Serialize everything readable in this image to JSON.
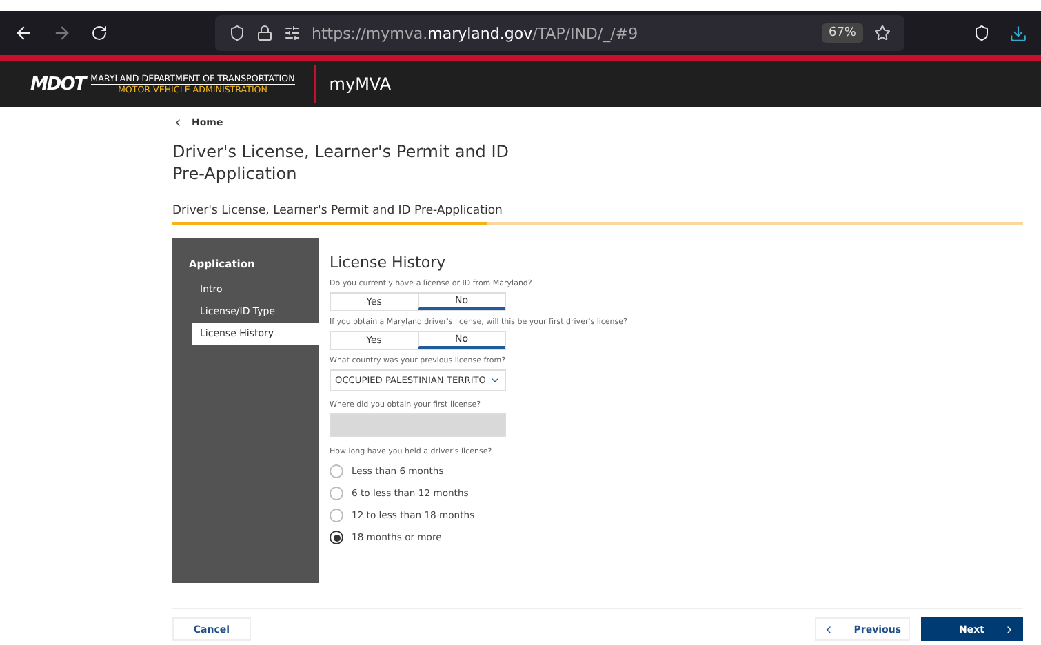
{
  "browser": {
    "url": "https://mymva.**maryland.gov**/TAP/IND/_/#9",
    "zoom": "67%"
  },
  "header": {
    "logo": "MDOT",
    "agency": "MARYLAND DEPARTMENT OF TRANSPORTATION",
    "division": "MOTOR VEHICLE ADMINISTRATION",
    "app": "myMVA"
  },
  "breadcrumb": "Home",
  "page_title": "Driver's License, Learner's Permit and ID Pre-Application",
  "section_title": "Driver's License, Learner's Permit and ID Pre-Application",
  "progress": {
    "level": 0.37
  },
  "sidebar": {
    "heading": "Application",
    "items": [
      {
        "label": "Intro",
        "selected": false
      },
      {
        "label": "License/ID Type",
        "selected": false
      },
      {
        "label": "License History",
        "selected": true
      }
    ]
  },
  "form": {
    "heading": "License History",
    "questions": [
      {
        "kind": "toggle",
        "label": "Do you currently have a license or ID from Maryland?",
        "options": [
          {
            "label": "Yes",
            "selected": false
          },
          {
            "label": "No",
            "selected": true
          }
        ]
      },
      {
        "kind": "toggle",
        "label": "If you obtain a Maryland driver's license, will this be your first driver's license?",
        "options": [
          {
            "label": "Yes",
            "selected": false
          },
          {
            "label": "No",
            "selected": true
          }
        ]
      },
      {
        "kind": "select",
        "label": "What country was your previous license from?",
        "value": "OCCUPIED PALESTINIAN TERRITO"
      },
      {
        "kind": "text",
        "label": "Where did you obtain your first license?",
        "disabled": true
      },
      {
        "kind": "radio",
        "label": "How long have you held a driver's license?",
        "options": [
          {
            "label": "Less than 6 months",
            "selected": false
          },
          {
            "label": "6 to less than 12 months",
            "selected": false
          },
          {
            "label": "12 to less than 18 months",
            "selected": false
          },
          {
            "label": "18 months or more",
            "selected": true
          }
        ]
      }
    ]
  },
  "footer": {
    "cancel": "Cancel",
    "previous": "Previous",
    "next": "Next"
  }
}
